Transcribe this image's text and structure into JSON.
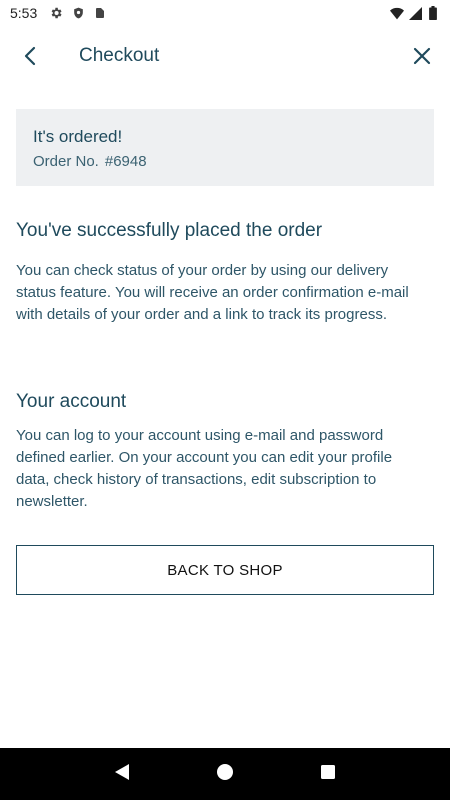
{
  "status_bar": {
    "time": "5:53",
    "icons": [
      "gear-icon",
      "shield-icon",
      "sd-card-icon",
      "wifi-icon",
      "signal-icon",
      "battery-icon"
    ]
  },
  "app_bar": {
    "title": "Checkout",
    "back_icon": "chevron-left-icon",
    "close_icon": "close-icon"
  },
  "order_box": {
    "title": "It's ordered!",
    "order_label": "Order No.",
    "order_number": "#6948"
  },
  "success_section": {
    "heading": "You've successfully placed the order",
    "body": "You can check status of your order by using our delivery status feature. You will receive an order confirmation e-mail with details of your order and a link to track its progress."
  },
  "account_section": {
    "heading": "Your account",
    "body": "You can log to your account using e-mail and password defined earlier. On your account you can edit your profile data, check history of transactions, edit subscription to newsletter."
  },
  "back_to_shop_label": "BACK TO SHOP",
  "nav_bar": {
    "icons": [
      "back-triangle-icon",
      "home-circle-icon",
      "recents-square-icon"
    ]
  },
  "colors": {
    "primary": "#1f4a5c",
    "order_box_bg": "#eef0f2",
    "nav_bar_bg": "#000000"
  }
}
